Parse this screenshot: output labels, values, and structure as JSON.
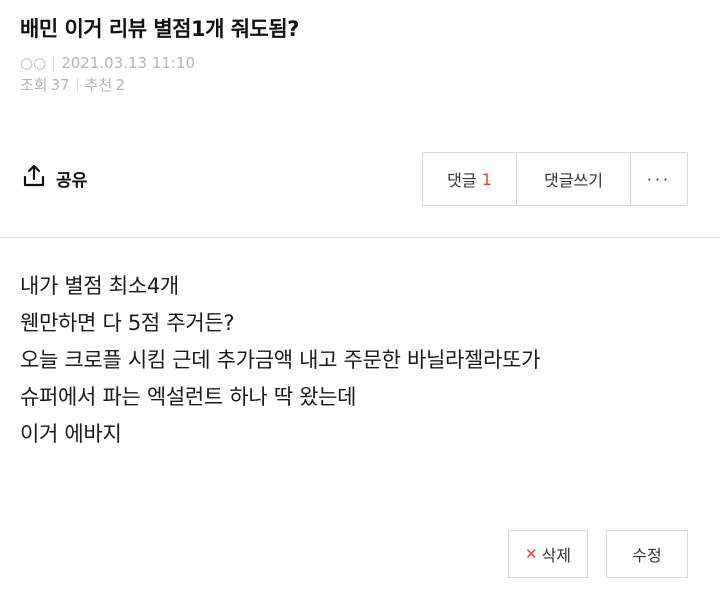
{
  "post": {
    "title": "배민 이거 리뷰 별점1개 줘도됨?",
    "author": "○○",
    "date": "2021.03.13 11:10",
    "views_label": "조회",
    "views": "37",
    "recommend_label": "추천",
    "recommend": "2"
  },
  "actions": {
    "share_label": "공유",
    "comments_label": "댓글",
    "comments_count": "1",
    "write_comment_label": "댓글쓰기",
    "more_label": "···"
  },
  "body": {
    "lines": [
      "내가 별점 최소4개",
      "웬만하면 다 5점 주거든?",
      "오늘 크로플 시킴 근데 추가금액 내고 주문한 바닐라젤라또가",
      "슈퍼에서 파는 엑설런트 하나 딱 왔는데",
      "이거 에바지"
    ]
  },
  "footer": {
    "delete_label": "삭제",
    "edit_label": "수정"
  },
  "colors": {
    "accent": "#e8453c",
    "meta_text": "#b5b5b5",
    "border": "#d9d9d9"
  }
}
